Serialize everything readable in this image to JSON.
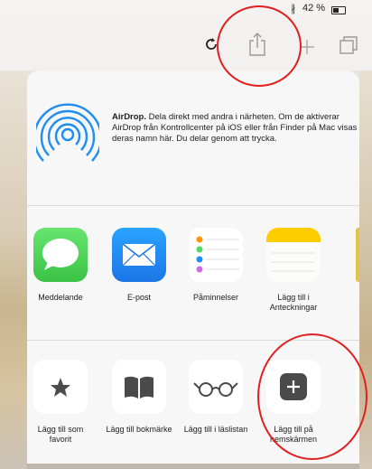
{
  "status_bar": {
    "bluetooth": "∦",
    "battery_percent": "42 %"
  },
  "toolbar": {
    "icons": [
      "reload-icon",
      "share-icon",
      "new-tab-icon",
      "tabs-icon"
    ]
  },
  "airdrop": {
    "text_bold": "AirDrop.",
    "text": "Dela direkt med andra i närheten. Om de aktiverar AirDrop från Kontrollcenter på iOS eller från Finder på Mac visas deras namn här. Du delar genom att trycka."
  },
  "apps": [
    {
      "label": "Meddelande",
      "icon": "messages-icon"
    },
    {
      "label": "E-post",
      "icon": "mail-icon"
    },
    {
      "label": "Påminnelser",
      "icon": "reminders-icon"
    },
    {
      "label": "Lägg till i Anteckningar",
      "icon": "notes-icon"
    }
  ],
  "actions": [
    {
      "label": "Lägg till som favorit",
      "icon": "star-icon"
    },
    {
      "label": "Lägg till bokmärke",
      "icon": "book-icon"
    },
    {
      "label": "Lägg till i läslistan",
      "icon": "glasses-icon"
    },
    {
      "label": "Lägg till på hemskärmen",
      "icon": "add-home-screen-icon"
    }
  ],
  "colors": {
    "annotation_red": "#e21f1f",
    "messages_green": "#4cd964",
    "mail_blue": "#1e8ef5",
    "notes_yellow": "#ffcc00",
    "airdrop_blue": "#1e8ef5"
  }
}
